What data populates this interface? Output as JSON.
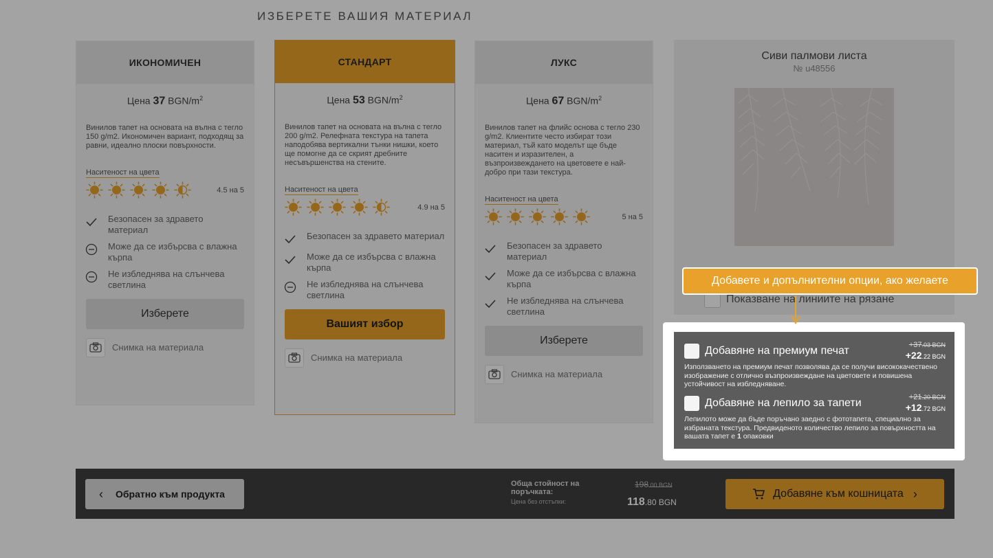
{
  "section_title": "ИЗБЕРЕТЕ ВАШИЯ МАТЕРИАЛ",
  "colors": {
    "accent": "#e8a12a",
    "dark": "#3f3f3f"
  },
  "materials": [
    {
      "name": "ИКОНОМИЧЕН",
      "price_prefix": "Цена",
      "price_value": "37",
      "price_unit": "BGN/m",
      "price_sup": "2",
      "description": "Винилов тапет на основата на вълна с тегло 150 g/m2. Икономичен вариант, подходящ за равни, идеално плоски повърхности.",
      "saturation_label": "Наситеност на цвета",
      "saturation_value": "4.5 на 5",
      "saturation_rating": 4.5,
      "features": [
        {
          "icon": "check-icon",
          "text": "Безопасен за здравето материал"
        },
        {
          "icon": "minus-circle-icon",
          "text": "Може да се избърсва с влажна кърпа"
        },
        {
          "icon": "minus-circle-icon",
          "text": "Не избледнява на слънчева светлина"
        }
      ],
      "button_label": "Изберете",
      "photo_label": "Снимка на материала"
    },
    {
      "name": "СТАНДАРТ",
      "price_prefix": "Цена",
      "price_value": "53",
      "price_unit": "BGN/m",
      "price_sup": "2",
      "description": "Винилов тапет на основата на вълна с тегло 200 g/m2. Релефната текстура на тапета наподобява вертикални тънки нишки, което ще помогне да се скрият дребните несъвършенства на стените.",
      "saturation_label": "Наситеност на цвета",
      "saturation_value": "4.9 на 5",
      "saturation_rating": 4.9,
      "features": [
        {
          "icon": "check-icon",
          "text": "Безопасен за здравето материал"
        },
        {
          "icon": "check-icon",
          "text": "Може да се избърсва с влажна кърпа"
        },
        {
          "icon": "minus-circle-icon",
          "text": "Не избледнява на слънчева светлина"
        }
      ],
      "button_label": "Вашият избор",
      "photo_label": "Снимка на материала"
    },
    {
      "name": "ЛУКС",
      "price_prefix": "Цена",
      "price_value": "67",
      "price_unit": "BGN/m",
      "price_sup": "2",
      "description": "Винилов тапет на флийс основа с тегло 230 g/m2. Клиентите често избират този материал, тъй като моделът ще бъде наситен и изразителен, а възпроизвеждането на цветовете е най-добро при тази текстура.",
      "saturation_label": "Наситеност на цвета",
      "saturation_value": "5 на 5",
      "saturation_rating": 5,
      "features": [
        {
          "icon": "check-icon",
          "text": "Безопасен за здравето материал"
        },
        {
          "icon": "check-icon",
          "text": "Може да се избърсва с влажна кърпа"
        },
        {
          "icon": "check-icon",
          "text": "Не избледнява на слънчева светлина"
        }
      ],
      "button_label": "Изберете",
      "photo_label": "Снимка на материала"
    }
  ],
  "product": {
    "name": "Сиви палмови листа",
    "number": "№ u48556"
  },
  "cut_lines_label": "Показване на линиите на рязане",
  "tooltip": "Добавете и допълнителни опции, ако желаете",
  "options": {
    "premium": {
      "title": "Добавяне на премиум печат",
      "old_int": "+37",
      "old_dec": ".03 BGN",
      "new_int": "+22",
      "new_dec": ".22 BGN",
      "description": "Използването на премиум печат позволява да се получи висококачествено изображение с отлично възпроизвеждане на цветовете и повишена устойчивост на избледняване."
    },
    "glue": {
      "title": "Добавяне на лепило за тапети",
      "old_int": "+21",
      "old_dec": ".20 BGN",
      "new_int": "+12",
      "new_dec": ".72 BGN",
      "description_pre": "Лепилото може да бъде поръчано заедно с фототапета, специално за избраната текстура. Предвиденото количество лепило за повърхността на вашата тапет е",
      "description_qty": "1",
      "description_post": "опаковки"
    }
  },
  "footer": {
    "back_label": "Обратно към продукта",
    "total_label": "Обща стойност на поръчката:",
    "total_sub": "Цена без отстъпки:",
    "total_old_int": "198",
    "total_old_dec": ".00 BGN",
    "total_new_int": "118",
    "total_new_dec": ".80 BGN",
    "cart_label": "Добавяне към кошницата"
  }
}
